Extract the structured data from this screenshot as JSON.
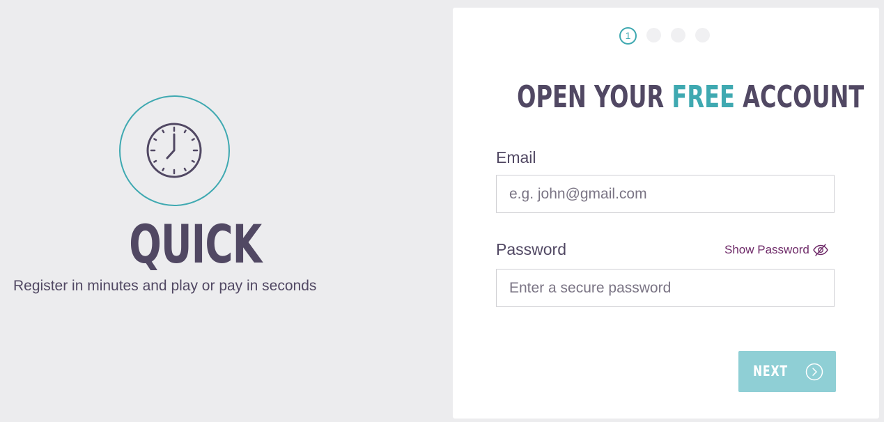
{
  "promo": {
    "icon": "clock-icon",
    "title": "QUICK",
    "subtitle": "Register in minutes and play or pay in seconds"
  },
  "steps": {
    "current": "1",
    "total": 4
  },
  "heading": {
    "part1": "OPEN YOUR ",
    "accent": "FREE",
    "part2": " ACCOUNT"
  },
  "form": {
    "email_label": "Email",
    "email_placeholder": "e.g. john@gmail.com",
    "email_value": "",
    "password_label": "Password",
    "password_placeholder": "Enter a secure password",
    "password_value": "",
    "show_password": "Show Password",
    "show_password_icon": "eye-slash-icon",
    "next_label": "NEXT",
    "next_icon": "chevron-right-circle-icon"
  },
  "colors": {
    "background": "#ececee",
    "card": "#ffffff",
    "text": "#514863",
    "accent": "#3fa9b1",
    "button": "#8fcfd5",
    "link": "#6e2a68"
  }
}
